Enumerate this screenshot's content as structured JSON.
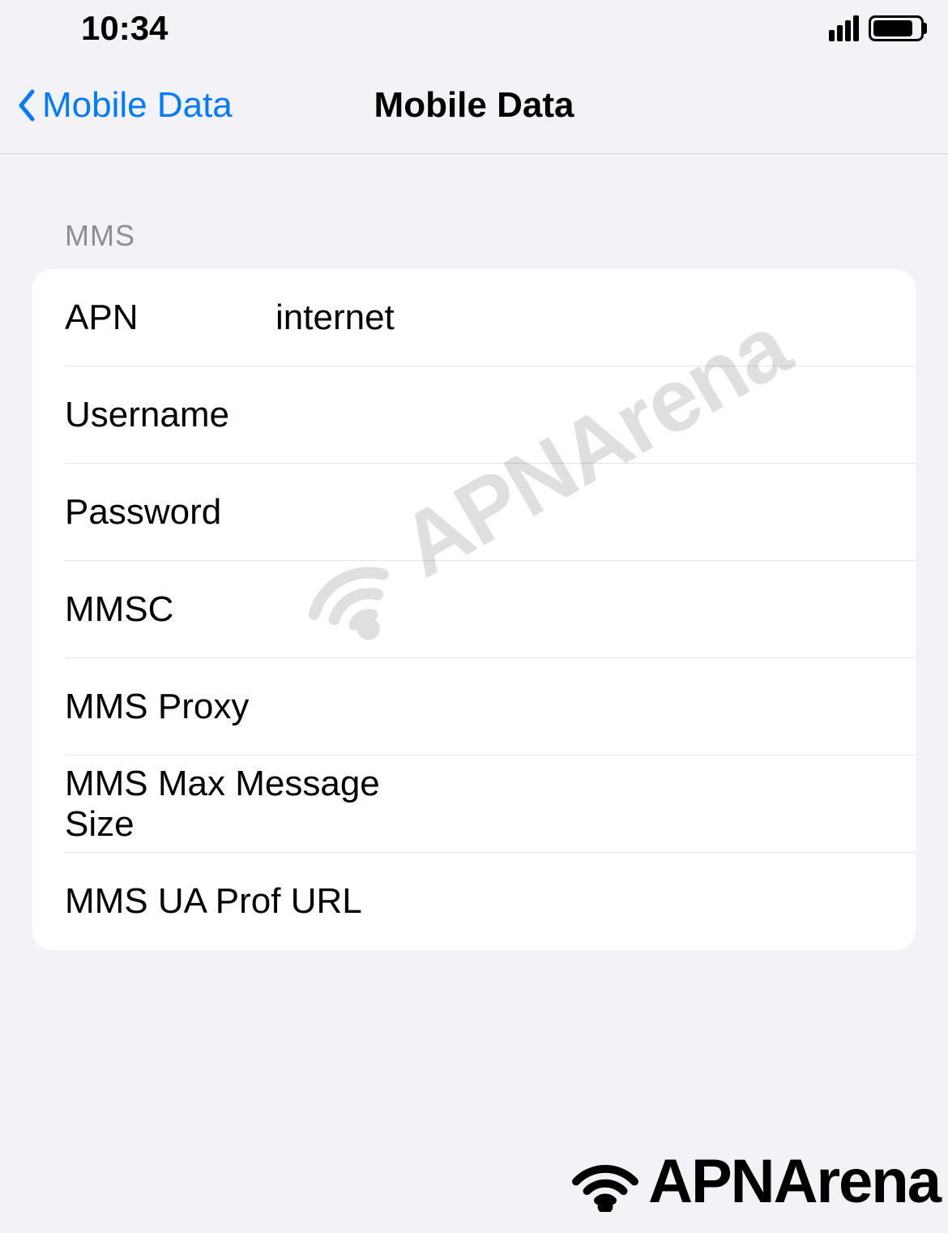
{
  "status_bar": {
    "time": "10:34"
  },
  "nav": {
    "back_label": "Mobile Data",
    "title": "Mobile Data"
  },
  "section": {
    "header": "MMS",
    "rows": [
      {
        "label": "APN",
        "value": "internet"
      },
      {
        "label": "Username",
        "value": ""
      },
      {
        "label": "Password",
        "value": ""
      },
      {
        "label": "MMSC",
        "value": ""
      },
      {
        "label": "MMS Proxy",
        "value": ""
      },
      {
        "label": "MMS Max Message Size",
        "value": ""
      },
      {
        "label": "MMS UA Prof URL",
        "value": ""
      }
    ]
  },
  "branding": {
    "name": "APNArena"
  }
}
